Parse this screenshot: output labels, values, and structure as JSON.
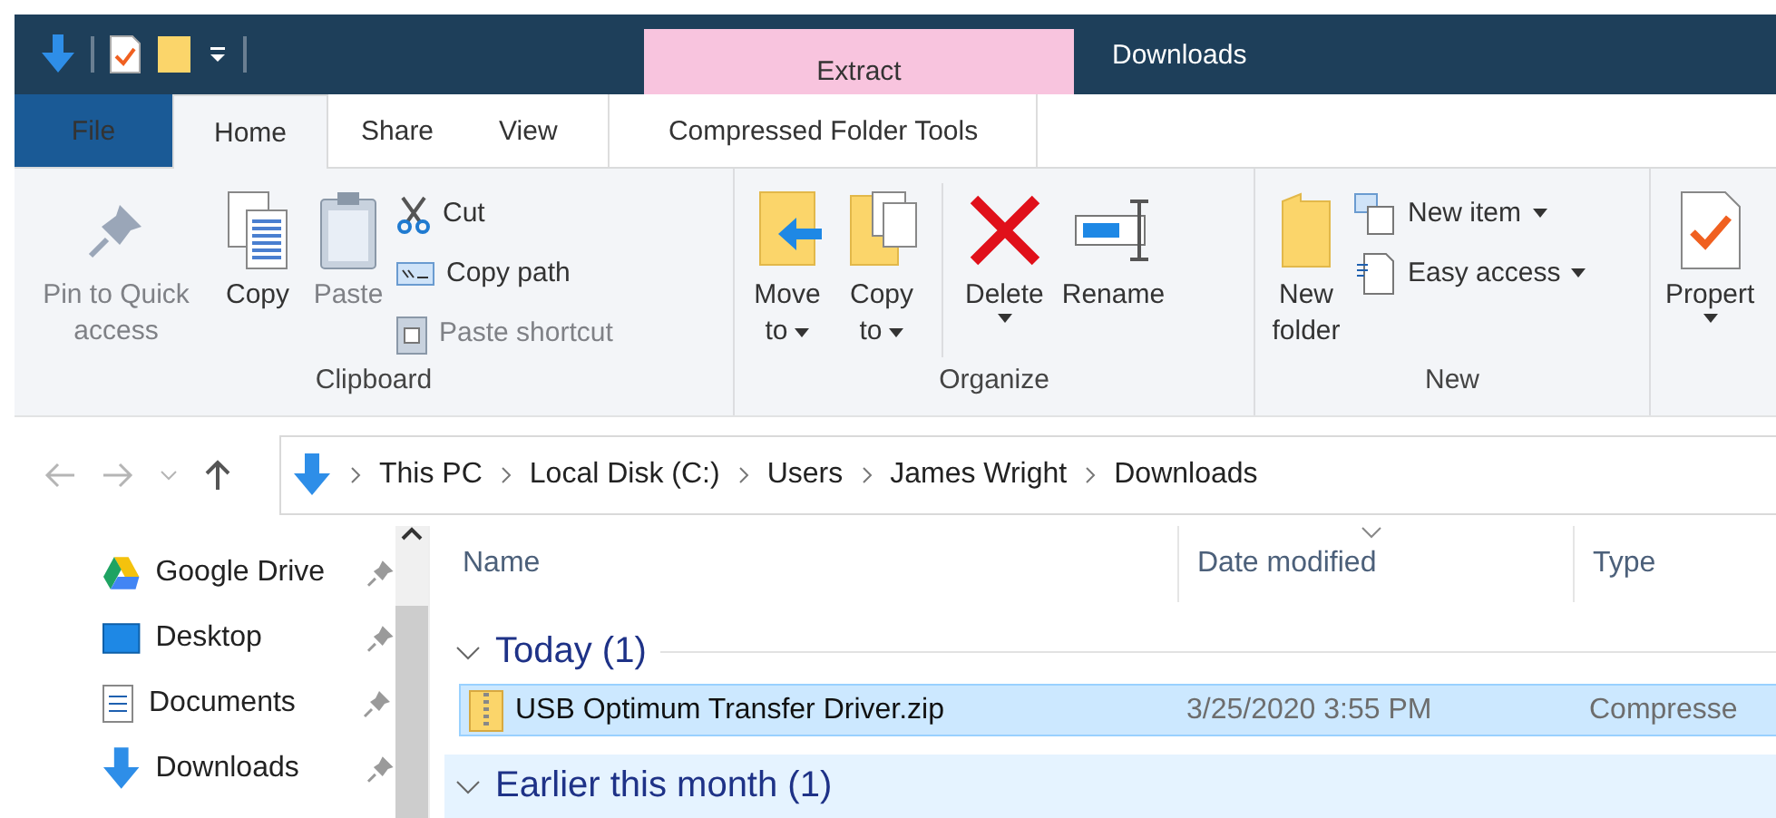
{
  "window": {
    "title": "Downloads"
  },
  "context_tab": {
    "label": "Extract"
  },
  "ribbon_tabs": [
    {
      "label": "File",
      "kind": "file",
      "selected": false
    },
    {
      "label": "Home",
      "kind": "tab",
      "selected": true
    },
    {
      "label": "Share",
      "kind": "tab",
      "selected": false
    },
    {
      "label": "View",
      "kind": "tab",
      "selected": false
    },
    {
      "label": "Compressed Folder Tools",
      "kind": "context",
      "selected": false
    }
  ],
  "ribbon_groups": [
    {
      "label": "Clipboard",
      "items": [
        {
          "label": "Pin to Quick access",
          "kind": "large",
          "disabled": true,
          "dropdown": false
        },
        {
          "label": "Copy",
          "kind": "large",
          "disabled": false,
          "dropdown": false
        },
        {
          "label": "Paste",
          "kind": "large",
          "disabled": true,
          "dropdown": false
        },
        {
          "kind": "stack",
          "items": [
            {
              "label": "Cut",
              "disabled": false,
              "dropdown": false
            },
            {
              "label": "Copy path",
              "disabled": false,
              "dropdown": false
            },
            {
              "label": "Paste shortcut",
              "disabled": true,
              "dropdown": false
            }
          ]
        }
      ]
    },
    {
      "label": "Organize",
      "items": [
        {
          "label": "Move to",
          "kind": "large",
          "disabled": false,
          "dropdown": true
        },
        {
          "label": "Copy to",
          "kind": "large",
          "disabled": false,
          "dropdown": true
        },
        {
          "kind": "separator"
        },
        {
          "label": "Delete",
          "kind": "large",
          "disabled": false,
          "dropdown": true
        },
        {
          "label": "Rename",
          "kind": "large",
          "disabled": false,
          "dropdown": false
        }
      ]
    },
    {
      "label": "New",
      "items": [
        {
          "label": "New folder",
          "kind": "large",
          "disabled": false,
          "dropdown": false
        },
        {
          "kind": "stack",
          "items": [
            {
              "label": "New item",
              "disabled": false,
              "dropdown": true
            },
            {
              "label": "Easy access",
              "disabled": false,
              "dropdown": true
            }
          ]
        }
      ]
    },
    {
      "items": [
        {
          "label": "Propert",
          "kind": "large",
          "disabled": false,
          "dropdown": true
        }
      ]
    }
  ],
  "breadcrumb": [
    "This PC",
    "Local Disk (C:)",
    "Users",
    "James Wright",
    "Downloads"
  ],
  "nav_items": [
    {
      "label": "Google Drive",
      "pinned": true
    },
    {
      "label": "Desktop",
      "pinned": true
    },
    {
      "label": "Documents",
      "pinned": true
    },
    {
      "label": "Downloads",
      "pinned": true
    }
  ],
  "columns": [
    {
      "label": "Name",
      "sorted": false
    },
    {
      "label": "Date modified",
      "sorted": true
    },
    {
      "label": "Type",
      "sorted": false
    }
  ],
  "file_groups": [
    {
      "label": "Today (1)",
      "expanded": true,
      "hovered": false,
      "rows": [
        {
          "name": "USB Optimum Transfer Driver.zip",
          "date": "3/25/2020 3:55 PM",
          "type": "Compresse",
          "selected": true
        }
      ]
    },
    {
      "label": "Earlier this month (1)",
      "expanded": true,
      "hovered": true
    }
  ]
}
